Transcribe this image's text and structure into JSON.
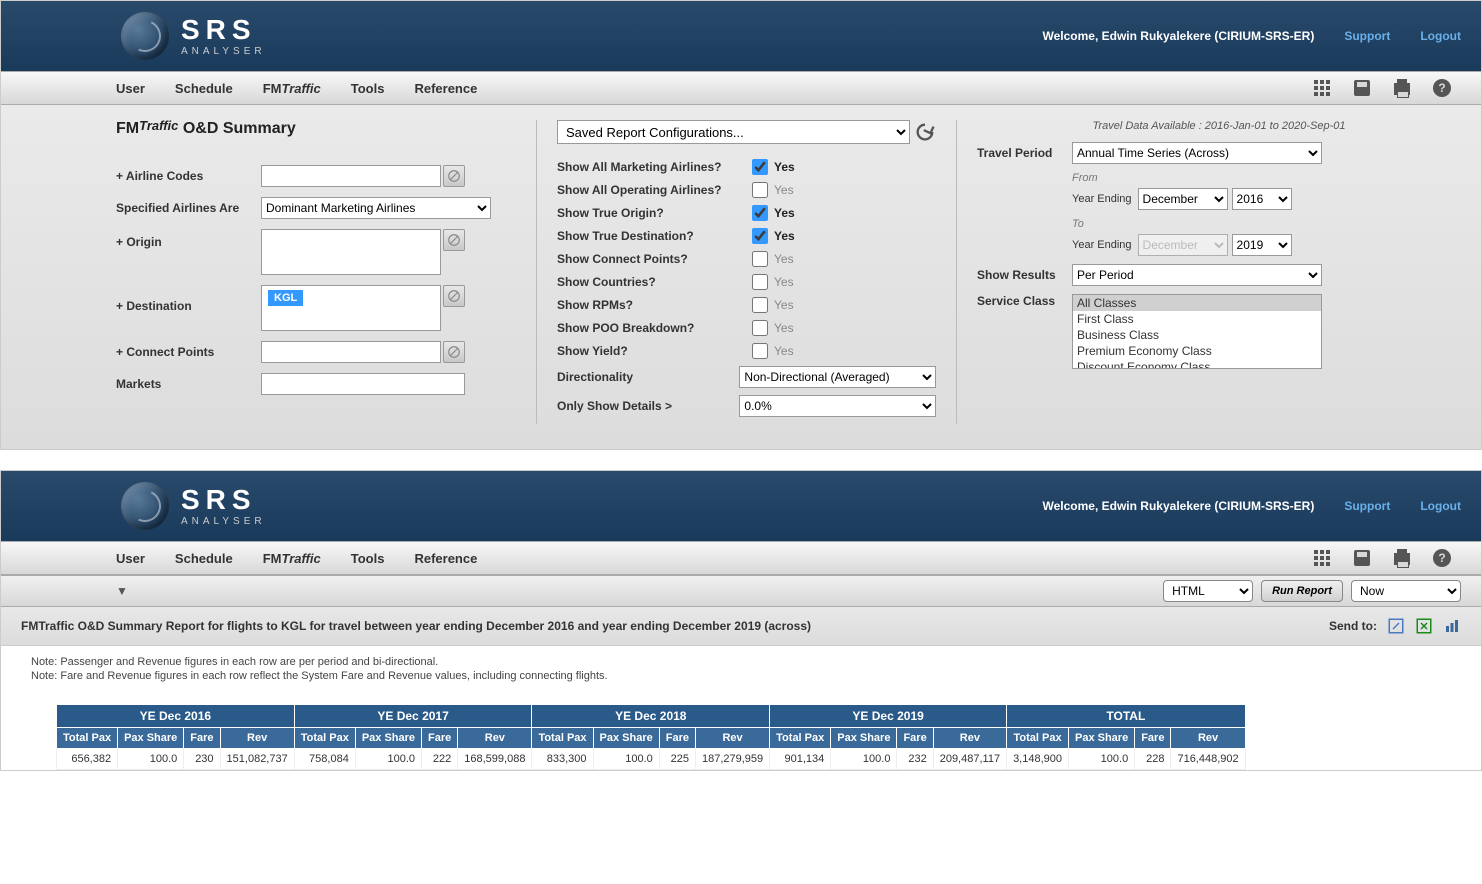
{
  "header": {
    "brand_main": "SRS",
    "brand_sub": "ANALYSER",
    "welcome": "Welcome, Edwin Rukyalekere (CIRIUM-SRS-ER)",
    "support": "Support",
    "logout": "Logout"
  },
  "menu": {
    "user": "User",
    "schedule": "Schedule",
    "fm_prefix": "FM",
    "fm_suffix": "Traffic",
    "tools": "Tools",
    "reference": "Reference"
  },
  "page": {
    "title_fm": "FM",
    "title_traffic": "Traffic",
    "title_rest": " O&D Summary",
    "saved_config": "Saved Report Configurations..."
  },
  "col1": {
    "airline_codes": "+ Airline Codes",
    "specified_airlines": "Specified Airlines Are",
    "specified_airlines_val": "Dominant Marketing Airlines",
    "origin": "+ Origin",
    "destination": "+ Destination",
    "destination_chip": "KGL",
    "connect_points": "+ Connect Points",
    "markets": "Markets"
  },
  "col2": {
    "show_marketing": "Show All Marketing Airlines?",
    "show_operating": "Show All Operating Airlines?",
    "show_true_origin": "Show True Origin?",
    "show_true_dest": "Show True Destination?",
    "show_connect": "Show Connect Points?",
    "show_countries": "Show Countries?",
    "show_rpms": "Show RPMs?",
    "show_poo": "Show POO Breakdown?",
    "show_yield": "Show Yield?",
    "directionality": "Directionality",
    "directionality_val": "Non-Directional (Averaged)",
    "only_show": "Only Show Details >",
    "only_show_val": "0.0%",
    "yes": "Yes"
  },
  "col3": {
    "travel_note": "Travel Data Available :  2016-Jan-01 to 2020-Sep-01",
    "travel_period": "Travel Period",
    "travel_period_val": "Annual Time Series (Across)",
    "from": "From",
    "to": "To",
    "year_ending": "Year Ending",
    "month_dec": "December",
    "year_2016": "2016",
    "year_2019": "2019",
    "show_results": "Show Results",
    "show_results_val": "Per Period",
    "service_class": "Service Class",
    "classes": [
      "All Classes",
      "First Class",
      "Business Class",
      "Premium Economy Class",
      "Discount Economy Class"
    ]
  },
  "subbar": {
    "format": "HTML",
    "run": "Run Report",
    "when": "Now"
  },
  "report": {
    "title": "FMTraffic O&D Summary Report for flights to KGL for travel between year ending December 2016 and year ending December 2019 (across)",
    "send_to": "Send to:",
    "note1": "Note: Passenger and Revenue figures in each row are per period and bi-directional.",
    "note2": "Note: Fare and Revenue figures in each row reflect the System Fare and Revenue values, including connecting flights."
  },
  "table": {
    "groups": [
      "YE Dec 2016",
      "YE Dec 2017",
      "YE Dec 2018",
      "YE Dec 2019",
      "TOTAL"
    ],
    "cols": [
      "Total Pax",
      "Pax Share",
      "Fare",
      "Rev"
    ],
    "rows": [
      [
        "656,382",
        "100.0",
        "230",
        "151,082,737",
        "758,084",
        "100.0",
        "222",
        "168,599,088",
        "833,300",
        "100.0",
        "225",
        "187,279,959",
        "901,134",
        "100.0",
        "232",
        "209,487,117",
        "3,148,900",
        "100.0",
        "228",
        "716,448,902"
      ]
    ]
  }
}
